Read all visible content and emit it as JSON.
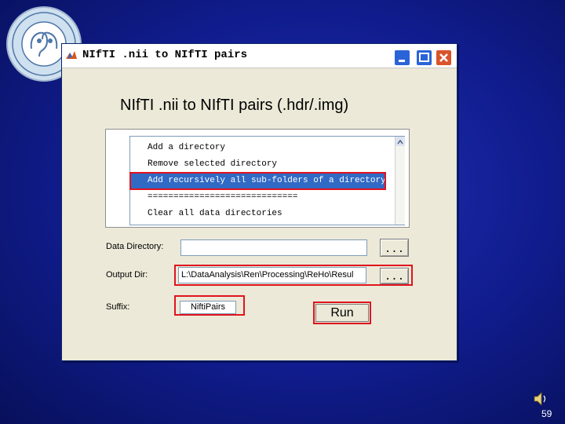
{
  "window": {
    "title": "NIfTI .nii to NIfTI pairs",
    "heading": "NIfTI .nii to NIfTI pairs (.hdr/.img)"
  },
  "directory_list": {
    "items": [
      {
        "label": "Add a directory",
        "selected": false
      },
      {
        "label": "Remove selected directory",
        "selected": false
      },
      {
        "label": "Add recursively all sub-folders of a directory",
        "selected": true
      },
      {
        "label": "=============================",
        "selected": false
      },
      {
        "label": "Clear all data directories",
        "selected": false
      }
    ]
  },
  "form": {
    "data_dir_label": "Data Directory:",
    "data_dir_value": "",
    "data_dir_browse": "...",
    "output_dir_label": "Output Dir:",
    "output_dir_value": "L:\\DataAnalysis\\Ren\\Processing\\ReHo\\Resul",
    "output_dir_browse": "...",
    "suffix_label": "Suffix:",
    "suffix_value": "NiftiPairs",
    "run_label": "Run"
  },
  "slide": {
    "page_number": "59"
  },
  "colors": {
    "highlight": "#e0141e",
    "selection": "#316ac5",
    "background": "#101c8c"
  },
  "icons": {
    "logo": "university-logo",
    "speaker": "speaker-icon",
    "app": "matlab-icon"
  }
}
